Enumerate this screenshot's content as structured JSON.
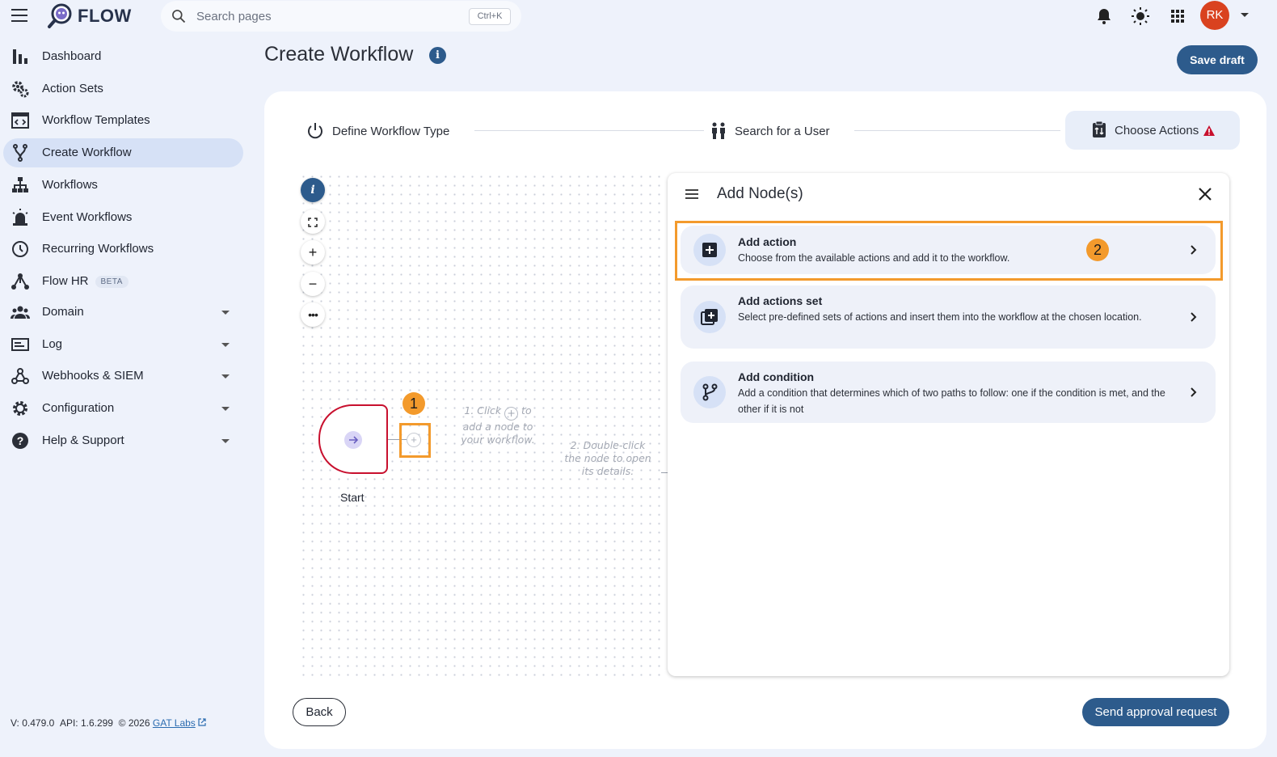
{
  "app": {
    "name": "FLOW"
  },
  "search": {
    "placeholder": "Search pages",
    "shortcut": "Ctrl+K"
  },
  "user": {
    "initials": "RK",
    "avatar_color": "#d9421f"
  },
  "sidebar": {
    "items": [
      {
        "label": "Dashboard",
        "icon": "bar-chart-icon"
      },
      {
        "label": "Action Sets",
        "icon": "gears-icon"
      },
      {
        "label": "Workflow Templates",
        "icon": "template-icon"
      },
      {
        "label": "Create Workflow",
        "icon": "fork-icon",
        "active": true
      },
      {
        "label": "Workflows",
        "icon": "hierarchy-icon"
      },
      {
        "label": "Event Workflows",
        "icon": "siren-icon"
      },
      {
        "label": "Recurring Workflows",
        "icon": "clock-icon"
      },
      {
        "label": "Flow HR",
        "icon": "network-icon",
        "badge": "BETA"
      },
      {
        "label": "Domain",
        "icon": "people-icon",
        "expandable": true
      },
      {
        "label": "Log",
        "icon": "log-icon",
        "expandable": true
      },
      {
        "label": "Webhooks & SIEM",
        "icon": "webhook-icon",
        "expandable": true
      },
      {
        "label": "Configuration",
        "icon": "gear-icon",
        "expandable": true
      },
      {
        "label": "Help & Support",
        "icon": "help-icon",
        "expandable": true
      }
    ]
  },
  "footer": {
    "version": "V: 0.479.0",
    "api": "API: 1.6.299",
    "copyright": "© 2026",
    "company": "GAT Labs"
  },
  "page": {
    "title": "Create Workflow",
    "save_draft": "Save draft"
  },
  "steps": [
    {
      "label": "Define Workflow Type",
      "icon": "power-icon"
    },
    {
      "label": "Search for a User",
      "icon": "users-icon"
    },
    {
      "label": "Choose Actions",
      "icon": "clipboard-icon",
      "current": true,
      "warning": true
    }
  ],
  "canvas": {
    "start_label": "Start",
    "hint1": [
      "1. Click",
      "to",
      "add a node to",
      "your workflow."
    ],
    "hint2": [
      "2. Double-click",
      "the node to open",
      "its details."
    ],
    "badge1": "1",
    "badge2": "2"
  },
  "panel": {
    "title": "Add Node(s)",
    "options": [
      {
        "title": "Add action",
        "desc": "Choose from the available actions and add it to the workflow.",
        "icon": "plus-box-icon"
      },
      {
        "title": "Add actions set",
        "desc": "Select pre-defined sets of actions and insert them into the workflow at the chosen location.",
        "icon": "library-add-icon"
      },
      {
        "title": "Add condition",
        "desc": "Add a condition that determines which of two paths to follow: one if the condition is met, and the other if it is not",
        "icon": "branch-icon"
      }
    ]
  },
  "actions": {
    "back": "Back",
    "send": "Send approval request"
  },
  "colors": {
    "primary": "#2d5b8c",
    "highlight": "#f39a2c",
    "danger": "#c8102e"
  }
}
